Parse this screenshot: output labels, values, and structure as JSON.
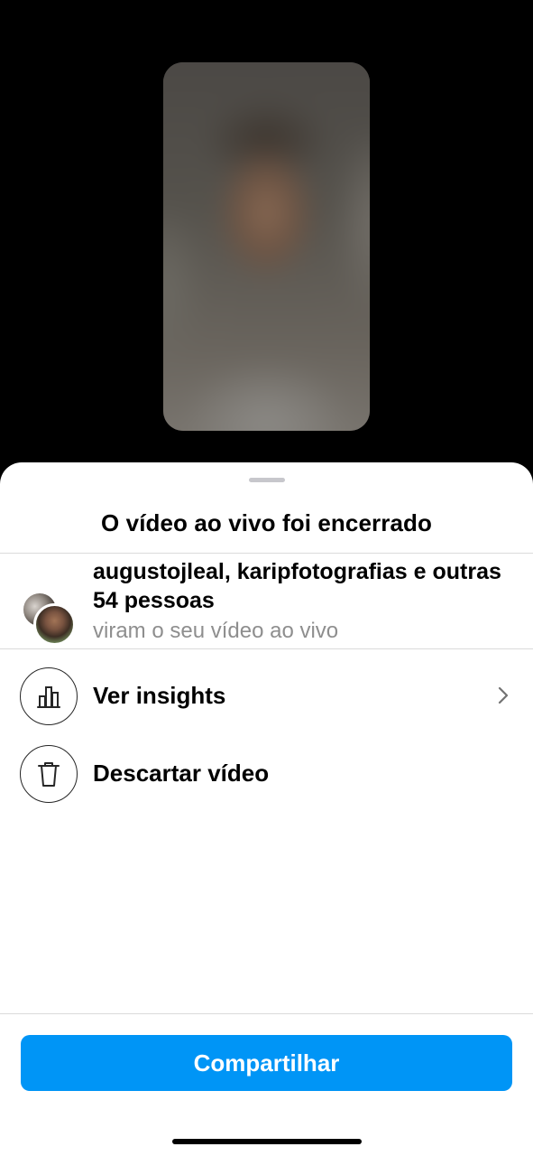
{
  "sheet": {
    "title": "O vídeo ao vivo foi encerrado"
  },
  "viewers": {
    "names": "augustojleal, karipfotografias e outras 54 pessoas",
    "subtitle": "viram o seu vídeo ao vivo"
  },
  "actions": [
    {
      "label": "Ver insights",
      "icon": "bar-chart-icon",
      "has_chevron": true
    },
    {
      "label": "Descartar vídeo",
      "icon": "trash-icon",
      "has_chevron": false
    }
  ],
  "share_button": {
    "label": "Compartilhar"
  },
  "colors": {
    "accent": "#0095f6",
    "divider": "#dbdbdb",
    "secondary_text": "#8e8e8e",
    "background": "#000000"
  }
}
